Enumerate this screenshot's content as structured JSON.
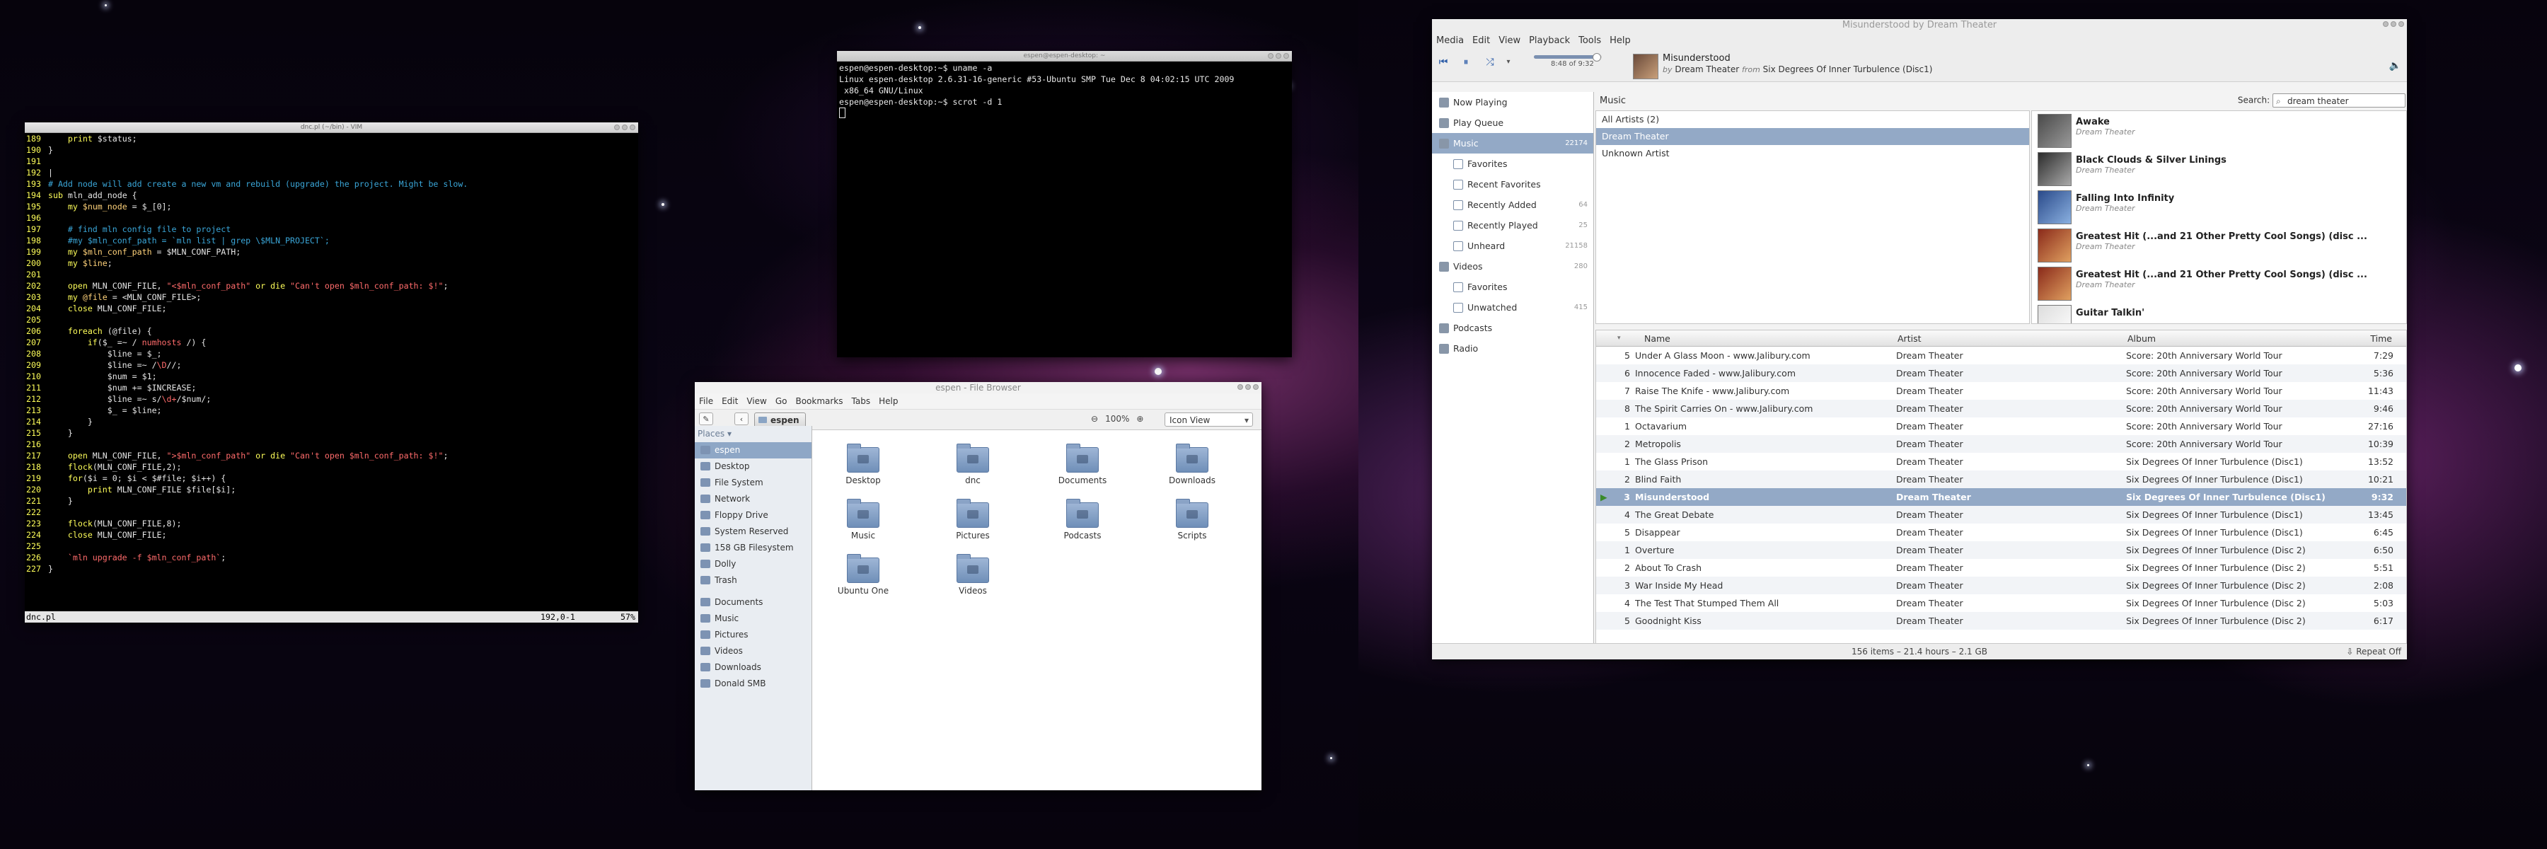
{
  "vim": {
    "title": "dnc.pl (~/bin) - VIM",
    "lines": [
      {
        "n": "189",
        "segs": [
          {
            "c": "plain",
            "t": "    "
          },
          {
            "c": "kw",
            "t": "print"
          },
          {
            "c": "plain",
            "t": " $status;"
          }
        ]
      },
      {
        "n": "190",
        "segs": [
          {
            "c": "plain",
            "t": "}"
          }
        ]
      },
      {
        "n": "191",
        "segs": []
      },
      {
        "n": "192",
        "segs": [
          {
            "c": "plain",
            "t": "|"
          }
        ]
      },
      {
        "n": "193",
        "segs": [
          {
            "c": "cm",
            "t": "# Add node will add create a new vm and rebuild (upgrade) the project. Might be slow."
          }
        ]
      },
      {
        "n": "194",
        "segs": [
          {
            "c": "kw",
            "t": "sub"
          },
          {
            "c": "plain",
            "t": " mln_add_node {"
          }
        ]
      },
      {
        "n": "195",
        "segs": [
          {
            "c": "plain",
            "t": "    "
          },
          {
            "c": "kw",
            "t": "my"
          },
          {
            "c": "var",
            "t": " $num_node"
          },
          {
            "c": "plain",
            "t": " = $_[0];"
          }
        ]
      },
      {
        "n": "196",
        "segs": []
      },
      {
        "n": "197",
        "segs": [
          {
            "c": "cm",
            "t": "    # find mln config file to project"
          }
        ]
      },
      {
        "n": "198",
        "segs": [
          {
            "c": "cm",
            "t": "    #my $mln_conf_path = `mln list | grep \\$MLN_PROJECT`;"
          }
        ]
      },
      {
        "n": "199",
        "segs": [
          {
            "c": "plain",
            "t": "    "
          },
          {
            "c": "kw",
            "t": "my"
          },
          {
            "c": "var",
            "t": " $mln_conf_path"
          },
          {
            "c": "plain",
            "t": " = $MLN_CONF_PATH;"
          }
        ]
      },
      {
        "n": "200",
        "segs": [
          {
            "c": "plain",
            "t": "    "
          },
          {
            "c": "kw",
            "t": "my"
          },
          {
            "c": "var",
            "t": " $line"
          },
          {
            "c": "plain",
            "t": ";"
          }
        ]
      },
      {
        "n": "201",
        "segs": []
      },
      {
        "n": "202",
        "segs": [
          {
            "c": "plain",
            "t": "    "
          },
          {
            "c": "kw",
            "t": "open"
          },
          {
            "c": "plain",
            "t": " MLN_CONF_FILE, "
          },
          {
            "c": "str",
            "t": "\"<$mln_conf_path\""
          },
          {
            "c": "plain",
            "t": " "
          },
          {
            "c": "kw",
            "t": "or die"
          },
          {
            "c": "plain",
            "t": " "
          },
          {
            "c": "str",
            "t": "\"Can't open $mln_conf_path: $!\""
          },
          {
            "c": "plain",
            "t": ";"
          }
        ]
      },
      {
        "n": "203",
        "segs": [
          {
            "c": "plain",
            "t": "    "
          },
          {
            "c": "kw",
            "t": "my"
          },
          {
            "c": "var",
            "t": " @file"
          },
          {
            "c": "plain",
            "t": " = <MLN_CONF_FILE>;"
          }
        ]
      },
      {
        "n": "204",
        "segs": [
          {
            "c": "plain",
            "t": "    "
          },
          {
            "c": "kw",
            "t": "close"
          },
          {
            "c": "plain",
            "t": " MLN_CONF_FILE;"
          }
        ]
      },
      {
        "n": "205",
        "segs": []
      },
      {
        "n": "206",
        "segs": [
          {
            "c": "plain",
            "t": "    "
          },
          {
            "c": "kw",
            "t": "foreach"
          },
          {
            "c": "plain",
            "t": " (@file) {"
          }
        ]
      },
      {
        "n": "207",
        "segs": [
          {
            "c": "plain",
            "t": "        "
          },
          {
            "c": "kw",
            "t": "if"
          },
          {
            "c": "plain",
            "t": "($_ =~ / "
          },
          {
            "c": "str",
            "t": "numhosts"
          },
          {
            "c": "plain",
            "t": " /) {"
          }
        ]
      },
      {
        "n": "208",
        "segs": [
          {
            "c": "plain",
            "t": "            $line = $_;"
          }
        ]
      },
      {
        "n": "209",
        "segs": [
          {
            "c": "plain",
            "t": "            $line =~ /"
          },
          {
            "c": "str",
            "t": "\\D"
          },
          {
            "c": "plain",
            "t": "//;"
          }
        ]
      },
      {
        "n": "210",
        "segs": [
          {
            "c": "plain",
            "t": "            $num = $1;"
          }
        ]
      },
      {
        "n": "211",
        "segs": [
          {
            "c": "plain",
            "t": "            $num += $INCREASE;"
          }
        ]
      },
      {
        "n": "212",
        "segs": [
          {
            "c": "plain",
            "t": "            $line =~ s/"
          },
          {
            "c": "str",
            "t": "\\d+"
          },
          {
            "c": "plain",
            "t": "/$num/;"
          }
        ]
      },
      {
        "n": "213",
        "segs": [
          {
            "c": "plain",
            "t": "            $_ = $line;"
          }
        ]
      },
      {
        "n": "214",
        "segs": [
          {
            "c": "plain",
            "t": "        }"
          }
        ]
      },
      {
        "n": "215",
        "segs": [
          {
            "c": "plain",
            "t": "    }"
          }
        ]
      },
      {
        "n": "216",
        "segs": []
      },
      {
        "n": "217",
        "segs": [
          {
            "c": "plain",
            "t": "    "
          },
          {
            "c": "kw",
            "t": "open"
          },
          {
            "c": "plain",
            "t": " MLN_CONF_FILE, "
          },
          {
            "c": "str",
            "t": "\">$mln_conf_path\""
          },
          {
            "c": "plain",
            "t": " "
          },
          {
            "c": "kw",
            "t": "or die"
          },
          {
            "c": "plain",
            "t": " "
          },
          {
            "c": "str",
            "t": "\"Can't open $mln_conf_path: $!\""
          },
          {
            "c": "plain",
            "t": ";"
          }
        ]
      },
      {
        "n": "218",
        "segs": [
          {
            "c": "plain",
            "t": "    "
          },
          {
            "c": "kw",
            "t": "flock"
          },
          {
            "c": "plain",
            "t": "(MLN_CONF_FILE,2);"
          }
        ]
      },
      {
        "n": "219",
        "segs": [
          {
            "c": "plain",
            "t": "    "
          },
          {
            "c": "kw",
            "t": "for"
          },
          {
            "c": "plain",
            "t": "($i = 0; $i < $#file; $i++) {"
          }
        ]
      },
      {
        "n": "220",
        "segs": [
          {
            "c": "plain",
            "t": "        "
          },
          {
            "c": "kw",
            "t": "print"
          },
          {
            "c": "plain",
            "t": " MLN_CONF_FILE $file[$i];"
          }
        ]
      },
      {
        "n": "221",
        "segs": [
          {
            "c": "plain",
            "t": "    }"
          }
        ]
      },
      {
        "n": "222",
        "segs": []
      },
      {
        "n": "223",
        "segs": [
          {
            "c": "plain",
            "t": "    "
          },
          {
            "c": "kw",
            "t": "flock"
          },
          {
            "c": "plain",
            "t": "(MLN_CONF_FILE,8);"
          }
        ]
      },
      {
        "n": "224",
        "segs": [
          {
            "c": "plain",
            "t": "    "
          },
          {
            "c": "kw",
            "t": "close"
          },
          {
            "c": "plain",
            "t": " MLN_CONF_FILE;"
          }
        ]
      },
      {
        "n": "225",
        "segs": []
      },
      {
        "n": "226",
        "segs": [
          {
            "c": "plain",
            "t": "    "
          },
          {
            "c": "str",
            "t": "`mln upgrade -f $mln_conf_path`"
          },
          {
            "c": "plain",
            "t": ";"
          }
        ]
      },
      {
        "n": "227",
        "segs": [
          {
            "c": "plain",
            "t": "}"
          }
        ]
      }
    ],
    "status_file": "dnc.pl",
    "status_pos": "192,0-1",
    "status_pct": "57%"
  },
  "terminal": {
    "title": "espen@espen-desktop: ~",
    "lines": [
      "espen@espen-desktop:~$ uname -a",
      "Linux espen-desktop 2.6.31-16-generic #53-Ubuntu SMP Tue Dec 8 04:02:15 UTC 2009",
      " x86_64 GNU/Linux",
      "espen@espen-desktop:~$ scrot -d 1"
    ]
  },
  "filebrowser": {
    "title": "espen - File Browser",
    "menu": [
      "File",
      "Edit",
      "View",
      "Go",
      "Bookmarks",
      "Tabs",
      "Help"
    ],
    "location": "espen",
    "zoom": "100%",
    "view_mode": "Icon View",
    "places_header": "Places ▾",
    "places": [
      {
        "label": "espen",
        "selected": true
      },
      {
        "label": "Desktop"
      },
      {
        "label": "File System"
      },
      {
        "label": "Network"
      },
      {
        "label": "Floppy Drive"
      },
      {
        "label": "System Reserved"
      },
      {
        "label": "158 GB Filesystem"
      },
      {
        "label": "Dolly"
      },
      {
        "label": "Trash"
      }
    ],
    "bookmarks": [
      "Documents",
      "Music",
      "Pictures",
      "Videos",
      "Downloads",
      "Donald SMB"
    ],
    "icons": [
      "Desktop",
      "dnc",
      "Documents",
      "Downloads",
      "Music",
      "Pictures",
      "Podcasts",
      "Scripts",
      "Ubuntu One",
      "Videos"
    ]
  },
  "player": {
    "title": "Misunderstood by Dream Theater",
    "menu": [
      "Media",
      "Edit",
      "View",
      "Playback",
      "Tools",
      "Help"
    ],
    "elapsed": "8:48 of 9:32",
    "progress": 0.92,
    "now_title": "Misunderstood",
    "now_by": "by",
    "now_artist": "Dream Theater",
    "now_from": "from",
    "now_album": "Six  Degrees Of  Inner Turbulence (Disc1)",
    "section_label": "Music",
    "search_label": "Search:",
    "search_value": "dream theater",
    "sources": [
      {
        "label": "Now Playing",
        "level": 0
      },
      {
        "label": "Play Queue",
        "level": 0
      },
      {
        "label": "Music",
        "count": "22174",
        "level": 0,
        "selected": true
      },
      {
        "label": "Favorites",
        "level": 1
      },
      {
        "label": "Recent Favorites",
        "level": 1
      },
      {
        "label": "Recently Added",
        "count": "64",
        "level": 1
      },
      {
        "label": "Recently Played",
        "count": "25",
        "level": 1
      },
      {
        "label": "Unheard",
        "count": "21158",
        "level": 1
      },
      {
        "label": "Videos",
        "count": "280",
        "level": 0
      },
      {
        "label": "Favorites",
        "level": 1
      },
      {
        "label": "Unwatched",
        "count": "415",
        "level": 1
      },
      {
        "label": "Podcasts",
        "level": 0
      },
      {
        "label": "Radio",
        "level": 0
      }
    ],
    "artists": [
      {
        "label": "All Artists (2)"
      },
      {
        "label": "Dream Theater",
        "selected": true
      },
      {
        "label": "Unknown Artist"
      }
    ],
    "albums": [
      {
        "title": "Awake",
        "artist": "Dream Theater"
      },
      {
        "title": "Black Clouds & Silver Linings",
        "artist": "Dream Theater"
      },
      {
        "title": "Falling Into Infinity",
        "artist": "Dream Theater"
      },
      {
        "title": "Greatest Hit (...and 21 Other Pretty Cool Songs) (disc ...",
        "artist": "Dream Theater"
      },
      {
        "title": "Greatest Hit (...and 21 Other Pretty Cool Songs) (disc ...",
        "artist": "Dream Theater"
      },
      {
        "title": "Guitar Talkin'",
        "artist": ""
      }
    ],
    "columns": {
      "name": "Name",
      "artist": "Artist",
      "album": "Album",
      "time": "Time"
    },
    "tracks": [
      {
        "n": "5",
        "name": "Under A Glass Moon - www.Jalibury.com",
        "artist": "Dream Theater",
        "album": "Score: 20th Anniversary World Tour",
        "time": "7:29"
      },
      {
        "n": "6",
        "name": "Innocence Faded - www.Jalibury.com",
        "artist": "Dream Theater",
        "album": "Score: 20th Anniversary World Tour",
        "time": "5:36"
      },
      {
        "n": "7",
        "name": "Raise The Knife - www.Jalibury.com",
        "artist": "Dream Theater",
        "album": "Score: 20th Anniversary World Tour",
        "time": "11:43"
      },
      {
        "n": "8",
        "name": "The Spirit Carries On - www.Jalibury.com",
        "artist": "Dream Theater",
        "album": "Score: 20th Anniversary World Tour",
        "time": "9:46"
      },
      {
        "n": "1",
        "name": "Octavarium",
        "artist": "Dream Theater",
        "album": "Score: 20th Anniversary World Tour",
        "time": "27:16"
      },
      {
        "n": "2",
        "name": "Metropolis",
        "artist": "Dream Theater",
        "album": "Score: 20th Anniversary World Tour",
        "time": "10:39"
      },
      {
        "n": "1",
        "name": "The Glass Prison",
        "artist": "Dream Theater",
        "album": "Six  Degrees Of  Inner Turbulence (Disc1)",
        "time": "13:52"
      },
      {
        "n": "2",
        "name": "Blind Faith",
        "artist": "Dream Theater",
        "album": "Six  Degrees Of  Inner Turbulence (Disc1)",
        "time": "10:21"
      },
      {
        "n": "3",
        "name": "Misunderstood",
        "artist": "Dream Theater",
        "album": "Six  Degrees Of  Inner Turbulence (Disc1)",
        "time": "9:32",
        "playing": true
      },
      {
        "n": "4",
        "name": "The Great Debate",
        "artist": "Dream Theater",
        "album": "Six  Degrees Of  Inner Turbulence (Disc1)",
        "time": "13:45"
      },
      {
        "n": "5",
        "name": "Disappear",
        "artist": "Dream Theater",
        "album": "Six  Degrees Of  Inner Turbulence (Disc1)",
        "time": "6:45"
      },
      {
        "n": "1",
        "name": "Overture",
        "artist": "Dream Theater",
        "album": "Six Degrees Of Inner Turbulence (Disc 2)",
        "time": "6:50"
      },
      {
        "n": "2",
        "name": "About To Crash",
        "artist": "Dream Theater",
        "album": "Six Degrees Of Inner Turbulence (Disc 2)",
        "time": "5:51"
      },
      {
        "n": "3",
        "name": "War Inside My Head",
        "artist": "Dream Theater",
        "album": "Six Degrees Of Inner Turbulence (Disc 2)",
        "time": "2:08"
      },
      {
        "n": "4",
        "name": "The Test That Stumped Them All",
        "artist": "Dream Theater",
        "album": "Six Degrees Of Inner Turbulence (Disc 2)",
        "time": "5:03"
      },
      {
        "n": "5",
        "name": "Goodnight Kiss",
        "artist": "Dream Theater",
        "album": "Six Degrees Of Inner Turbulence (Disc 2)",
        "time": "6:17"
      }
    ],
    "status": "156 items – 21.4 hours – 2.1 GB",
    "repeat": "Repeat Off"
  }
}
